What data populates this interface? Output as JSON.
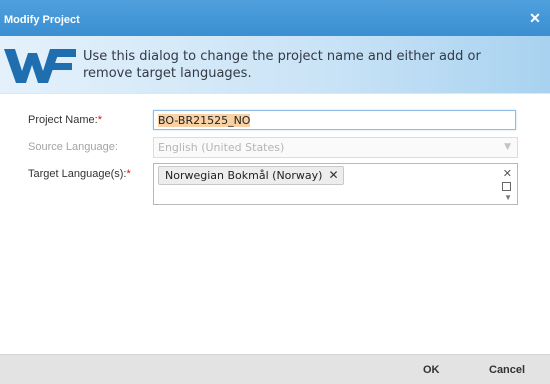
{
  "window": {
    "title": "Modify Project",
    "close_glyph": "✕"
  },
  "header": {
    "logo_icon": "wf-logo-icon",
    "description": "Use this dialog to change the project name and either add or remove target languages."
  },
  "form": {
    "project_name": {
      "label": "Project Name:",
      "required_mark": "*",
      "value": "BO-BR21525_NO"
    },
    "source_language": {
      "label": "Source Language:",
      "value": "English (United States)",
      "disabled": true
    },
    "target_languages": {
      "label": "Target Language(s):",
      "required_mark": "*",
      "selected": [
        "Norwegian Bokmål (Norway)"
      ],
      "chip_remove_glyph": "✕",
      "clear_glyph": "✕"
    }
  },
  "footer": {
    "ok_label": "OK",
    "cancel_label": "Cancel"
  },
  "colors": {
    "titlebar": "#3a8fd2",
    "required": "#d0161b",
    "selection_highlight": "#f8d1a4",
    "footer_bg": "#e3e3e3"
  }
}
